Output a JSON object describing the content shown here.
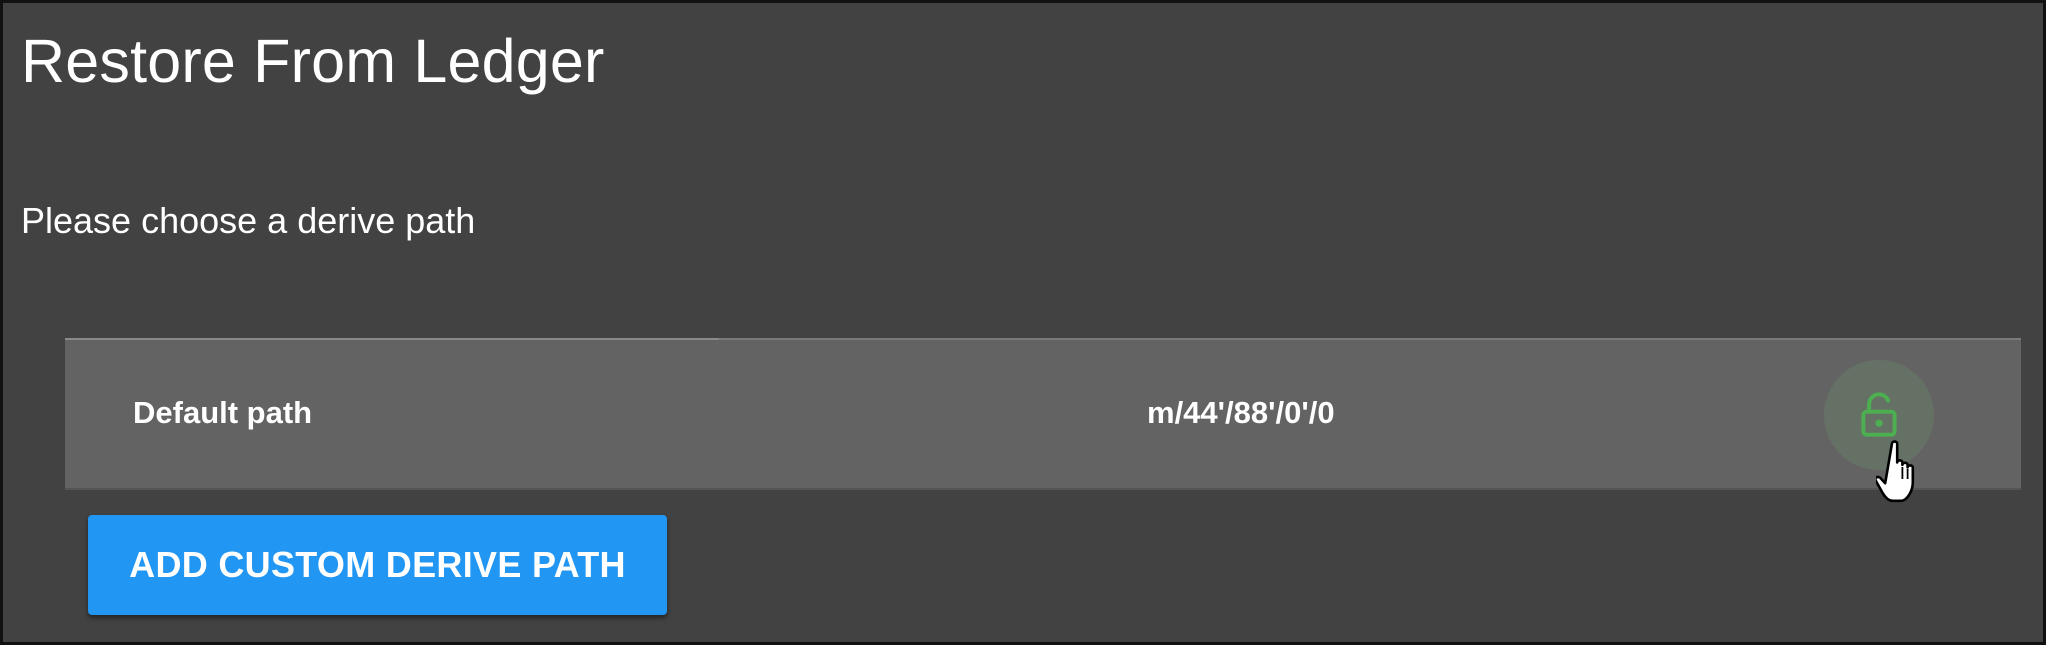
{
  "page": {
    "title": "Restore From Ledger",
    "instruction": "Please choose a derive path"
  },
  "derive_paths": [
    {
      "name": "Default path",
      "path": "m/44'/88'/0'/0",
      "lock_icon": "unlock-icon",
      "lock_state": "unlocked"
    }
  ],
  "actions": {
    "add_custom_label": "ADD CUSTOM DERIVE PATH"
  },
  "colors": {
    "background": "#424242",
    "row_background": "#636363",
    "accent_button": "#2196f3",
    "lock_icon": "#4caf50",
    "text": "#ffffff"
  },
  "cursor": {
    "icon": "hand-pointer-icon"
  }
}
